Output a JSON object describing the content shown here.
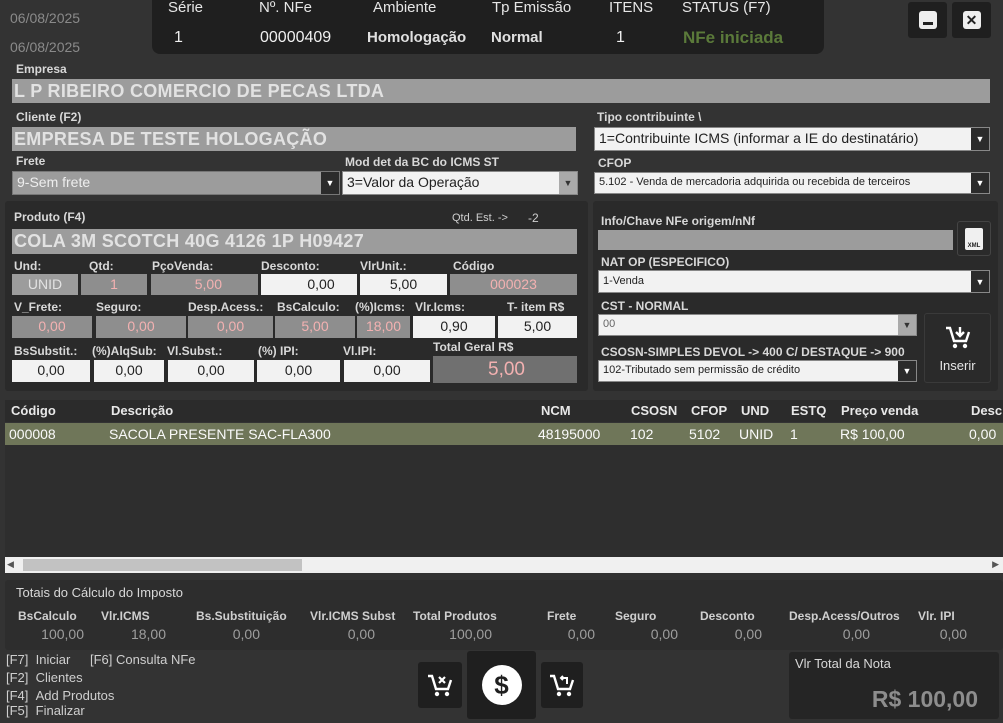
{
  "header": {
    "dates": [
      "06/08/2025",
      "06/08/2025"
    ],
    "columns": [
      "Série",
      "Nº. NFe",
      "Ambiente",
      "Tp Emissão",
      "ITENS",
      "STATUS (F7)"
    ],
    "values": {
      "serie": "1",
      "nfe": "00000409",
      "ambiente": "Homologação",
      "tp_emissao": "Normal",
      "itens": "1",
      "status": "NFe iniciada"
    },
    "status_color": "#5b7a3a"
  },
  "empresa": {
    "label": "Empresa",
    "value": "L P RIBEIRO COMERCIO DE PECAS LTDA"
  },
  "cliente": {
    "label": "Cliente (F2)",
    "value": "EMPRESA DE TESTE HOLOGAÇÃO"
  },
  "tipo_contribuinte": {
    "label": "Tipo contribuinte \\",
    "value": "1=Contribuinte ICMS (informar a IE do destinatário)"
  },
  "frete": {
    "label": "Frete",
    "value": "9-Sem frete"
  },
  "mod_bc": {
    "label": "Mod det da BC do ICMS ST",
    "value": "3=Valor da Operação"
  },
  "cfop": {
    "label": "CFOP",
    "value": "5.102 - Venda de mercadoria adquirida ou recebida de terceiros"
  },
  "produto": {
    "label": "Produto (F4)",
    "qtd_est_label": "Qtd. Est. ->",
    "qtd_est_value": "-2",
    "name": "COLA 3M SCOTCH 40G 4126 1P H09427",
    "row1": {
      "labels": [
        "Und:",
        "Qtd:",
        "PçoVenda:",
        "Desconto:",
        "VlrUnit.:",
        "Código"
      ],
      "values": [
        "UNID",
        "1",
        "5,00",
        "0,00",
        "5,00",
        "000023"
      ]
    },
    "row2": {
      "labels": [
        "V_Frete:",
        "Seguro:",
        "Desp.Acess.:",
        "BsCalculo:",
        "(%)Icms:",
        "Vlr.Icms:",
        "T- item R$"
      ],
      "values": [
        "0,00",
        "0,00",
        "0,00",
        "5,00",
        "18,00",
        "0,90",
        "5,00"
      ]
    },
    "row3": {
      "labels": [
        "BsSubstit.:",
        "(%)AlqSub:",
        "Vl.Subst.:",
        "(%) IPI:",
        "Vl.IPI:",
        "Total Geral R$"
      ],
      "values": [
        "0,00",
        "0,00",
        "0,00",
        "0,00",
        "0,00",
        "5,00"
      ]
    }
  },
  "right_panel": {
    "info_chave_label": "Info/Chave NFe origem/nNf",
    "info_chave_value": "",
    "nat_op_label": "NAT OP (ESPECIFICO)",
    "nat_op_value": "1-Venda",
    "cst_label": "CST - NORMAL",
    "cst_value": "00",
    "csosn_label": "CSOSN-SIMPLES  DEVOL -> 400 C/ DESTAQUE -> 900",
    "csosn_value": "102-Tributado sem permissão de crédito",
    "inserir_label": "Inserir",
    "xml_label": "XML"
  },
  "table": {
    "columns": [
      "Código",
      "Descrição",
      "NCM",
      "CSOSN",
      "CFOP",
      "UND",
      "ESTQ",
      "Preço venda",
      "Desc"
    ],
    "rows": [
      [
        "000008",
        "SACOLA PRESENTE SAC-FLA300",
        "48195000",
        "102",
        "5102",
        "UNID",
        "1",
        "R$ 100,00",
        "0,00"
      ]
    ],
    "row_color": "#6f7659"
  },
  "totais": {
    "title": "Totais do Cálculo do Imposto",
    "labels": [
      "BsCalculo",
      "Vlr.ICMS",
      "Bs.Substituição",
      "Vlr.ICMS Subst",
      "Total Produtos",
      "Frete",
      "Seguro",
      "Desconto",
      "Desp.Acess/Outros",
      "Vlr. IPI"
    ],
    "values": [
      "100,00",
      "18,00",
      "0,00",
      "0,00",
      "100,00",
      "0,00",
      "0,00",
      "0,00",
      "0,00",
      "0,00"
    ]
  },
  "shortcuts": [
    {
      "key": "[F7]",
      "label": "Iniciar"
    },
    {
      "key": "[F6]",
      "label": "Consulta NFe"
    },
    {
      "key": "[F2]",
      "label": "Clientes"
    },
    {
      "key": "[F4]",
      "label": "Add Produtos"
    },
    {
      "key": "[F5]",
      "label": "Finalizar"
    }
  ],
  "total_nota": {
    "label": "Vlr Total da Nota",
    "value": "R$ 100,00"
  }
}
